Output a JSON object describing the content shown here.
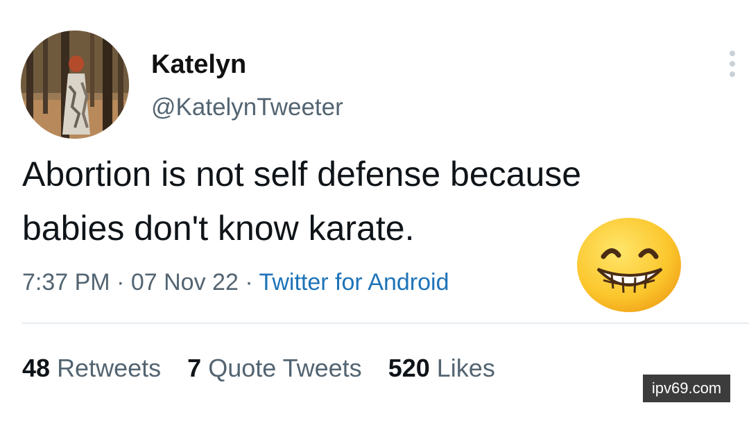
{
  "user": {
    "display_name": "Katelyn",
    "handle": "@KatelynTweeter",
    "avatar_icon": "profile-photo"
  },
  "tweet": {
    "text_lines": [
      "Abortion is not self defense because",
      "babies don't know karate."
    ],
    "time": "7:37 PM",
    "date": "07 Nov 22",
    "separator": "·",
    "source": "Twitter for Android",
    "emoji": "grinning-face-with-smiling-eyes"
  },
  "stats": {
    "retweets_count": "48",
    "retweets_label": "Retweets",
    "quotes_count": "7",
    "quotes_label": "Quote Tweets",
    "likes_count": "520",
    "likes_label": "Likes"
  },
  "watermark": "ipv69.com",
  "colors": {
    "text": "#0f1419",
    "secondary": "#536471",
    "link": "#1d73b8",
    "divider": "#e6ecf0"
  }
}
